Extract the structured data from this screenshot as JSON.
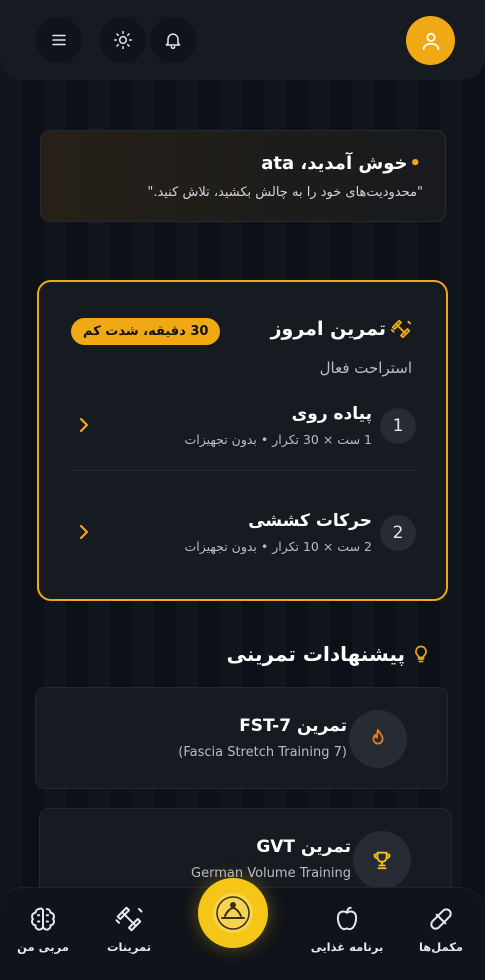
{
  "header": {
    "avatar_icon": "user-icon",
    "notifications_icon": "bell-icon",
    "theme_icon": "sun-icon",
    "menu_icon": "hamburger-menu-icon"
  },
  "welcome": {
    "title": "خوش آمدید، ata",
    "quote": "\"محدودیت‌های خود را به چالش بکشید، تلاش کنید.\""
  },
  "today_workout": {
    "title": "تمرین امروز",
    "badge": "30 دقیقه، شدت کم",
    "subtitle": "استراحت فعال",
    "exercises": [
      {
        "number": "1",
        "name": "پیاده روی",
        "detail": "1 ست × 30 تکرار • بدون تجهیزات"
      },
      {
        "number": "2",
        "name": "حرکات کششی",
        "detail": "2 ست × 10 تکرار • بدون تجهیزات"
      }
    ]
  },
  "suggestions": {
    "title": "پیشنهادات تمرینی",
    "items": [
      {
        "name": "تمرین FST-7",
        "desc": "(Fascia Stretch Training 7)",
        "icon": "fire-icon"
      },
      {
        "name": "تمرین GVT",
        "desc": "German Volume Training",
        "icon": "trophy-icon"
      }
    ]
  },
  "nav": {
    "coach": "مربی من",
    "workouts": "تمرینات",
    "nutrition": "برنامه غذایی",
    "supplements": "مکمل‌ها"
  },
  "colors": {
    "accent": "#f0a815",
    "background": "#0c1018",
    "card": "#161a21"
  }
}
